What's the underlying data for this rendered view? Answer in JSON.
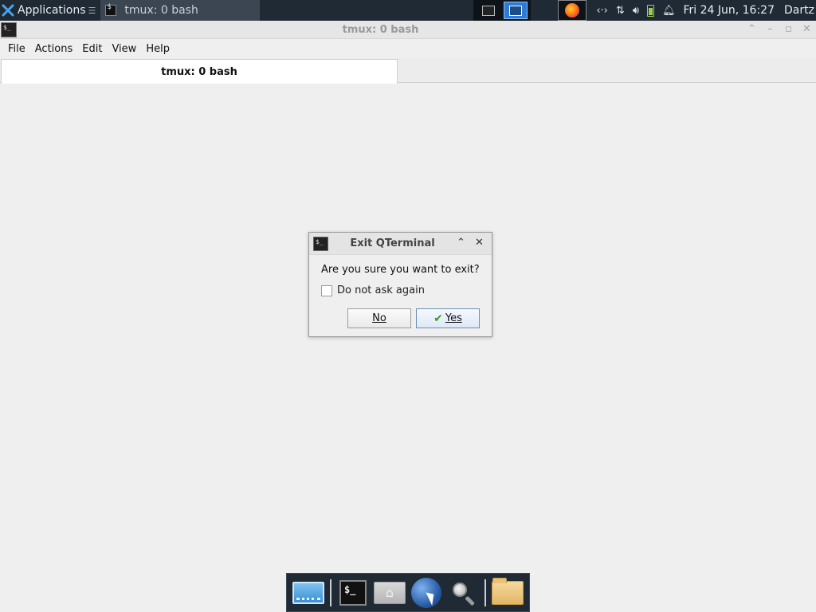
{
  "top_panel": {
    "applications_label": "Applications",
    "task_button_label": "tmux: 0 bash",
    "clock": "Fri 24 Jun, 16:27",
    "user": "Dartz"
  },
  "window": {
    "title": "tmux: 0 bash",
    "menu": {
      "file": "File",
      "actions": "Actions",
      "edit": "Edit",
      "view": "View",
      "help": "Help"
    },
    "tab_label": "tmux: 0 bash"
  },
  "dialog": {
    "title": "Exit QTerminal",
    "question": "Are you sure you want to exit?",
    "checkbox_label": "Do not ask again",
    "checkbox_checked": false,
    "no_label": "No",
    "yes_label": "Yes"
  },
  "dock": {
    "items": [
      "desktop-icon",
      "terminal-icon",
      "home-folder-icon",
      "web-browser-icon",
      "app-finder-icon",
      "file-manager-icon"
    ]
  },
  "colors": {
    "panel_bg": "#1f2a35",
    "active_workspace": "#2e7bd6",
    "window_bg": "#efefef"
  }
}
